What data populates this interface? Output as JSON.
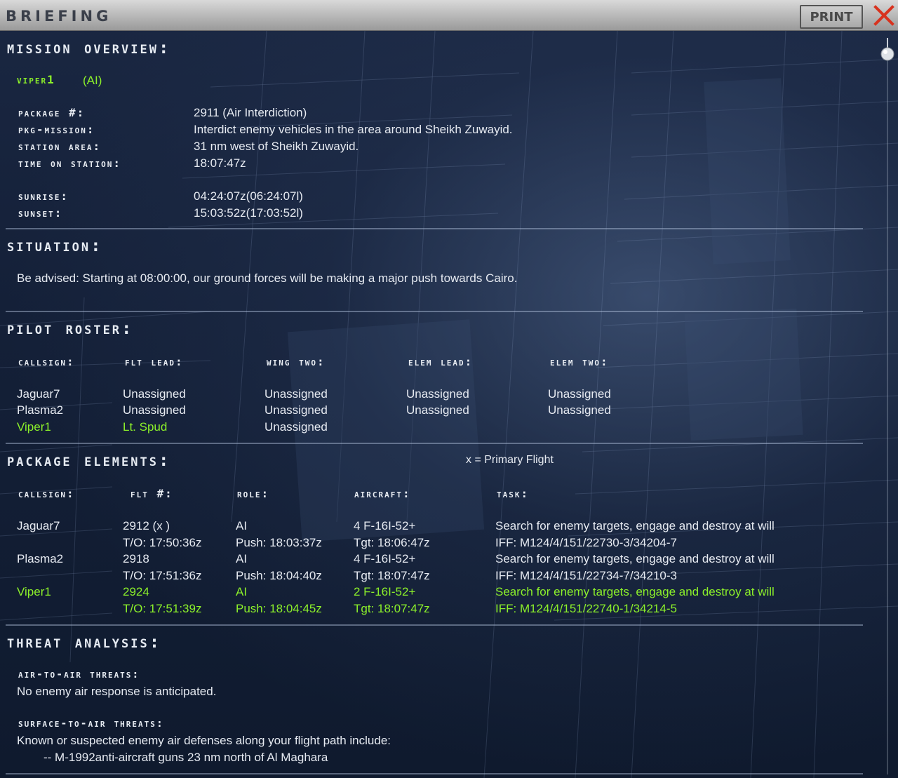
{
  "window": {
    "title": "BRIEFING",
    "print_label": "PRINT",
    "close_icon": "close-x-icon",
    "colors": {
      "accent_green": "#8cf02a",
      "text": "#e6eaf1",
      "close_red": "#d8321e"
    }
  },
  "mission_overview": {
    "heading": "Mission Overview:",
    "flight": "Viper1",
    "flight_suffix": "(AI)",
    "package_label": "Package #:",
    "package_value": "2911 (Air Interdiction)",
    "pkg_mission_label": "Pkg-Mission:",
    "pkg_mission_value": "Interdict enemy vehicles in the area around Sheikh Zuwayid.",
    "station_area_label": "Station Area:",
    "station_area_value": "31 nm west of Sheikh Zuwayid.",
    "time_on_station_label": "Time on Station:",
    "time_on_station_value": "18:07:47z",
    "sunrise_label": "Sunrise:",
    "sunrise_value": "04:24:07z(06:24:07l)",
    "sunset_label": "Sunset:",
    "sunset_value": "15:03:52z(17:03:52l)"
  },
  "situation": {
    "heading": "Situation:",
    "text": "Be advised: Starting at 08:00:00, our ground forces will be making a major push towards Cairo."
  },
  "pilot_roster": {
    "heading": "Pilot Roster:",
    "columns": [
      "Callsign:",
      "Flt Lead:",
      "Wing Two:",
      "Elem Lead:",
      "Elem Two:"
    ],
    "rows": [
      {
        "cells": [
          "Jaguar7",
          "Unassigned",
          "Unassigned",
          "Unassigned",
          "Unassigned"
        ],
        "highlight": false
      },
      {
        "cells": [
          "Plasma2",
          "Unassigned",
          "Unassigned",
          "Unassigned",
          "Unassigned"
        ],
        "highlight": false
      },
      {
        "cells": [
          "Viper1",
          "Lt. Spud",
          "Unassigned",
          "",
          ""
        ],
        "highlight": true
      }
    ]
  },
  "package_elements": {
    "heading": "Package Elements:",
    "legend": "x  = Primary Flight",
    "columns": [
      "Callsign:",
      "Flt #:",
      "Role:",
      "Aircraft:",
      "Task:"
    ],
    "rows": [
      {
        "callsign": "Jaguar7",
        "flt": "2912 (x )",
        "to": "T/O: 17:50:36z",
        "role": "AI",
        "push": "Push: 18:03:37z",
        "aircraft": "4 F-16I-52+",
        "tgt": "Tgt: 18:06:47z",
        "task": "Search for enemy targets, engage and destroy at will",
        "iff": "IFF: M124/4/151/22730-3/34204-7",
        "highlight": false
      },
      {
        "callsign": "Plasma2",
        "flt": "2918",
        "to": "T/O: 17:51:36z",
        "role": "AI",
        "push": "Push: 18:04:40z",
        "aircraft": "4 F-16I-52+",
        "tgt": "Tgt: 18:07:47z",
        "task": "Search for enemy targets, engage and destroy at will",
        "iff": "IFF: M124/4/151/22734-7/34210-3",
        "highlight": false
      },
      {
        "callsign": "Viper1",
        "flt": "2924",
        "to": "T/O: 17:51:39z",
        "role": "AI",
        "push": "Push: 18:04:45z",
        "aircraft": "2 F-16I-52+",
        "tgt": "Tgt: 18:07:47z",
        "task": "Search for enemy targets, engage and destroy at will",
        "iff": "IFF: M124/4/151/22740-1/34214-5",
        "highlight": true
      }
    ]
  },
  "threat_analysis": {
    "heading": "Threat Analysis:",
    "air_label": "Air-to-Air Threats:",
    "air_text": "No enemy air response is anticipated.",
    "sam_label": "Surface-To-Air Threats:",
    "sam_text": "Known or suspected enemy air defenses along your flight path include:",
    "sam_item": "-- M-1992anti-aircraft guns 23 nm north of Al Maghara"
  }
}
